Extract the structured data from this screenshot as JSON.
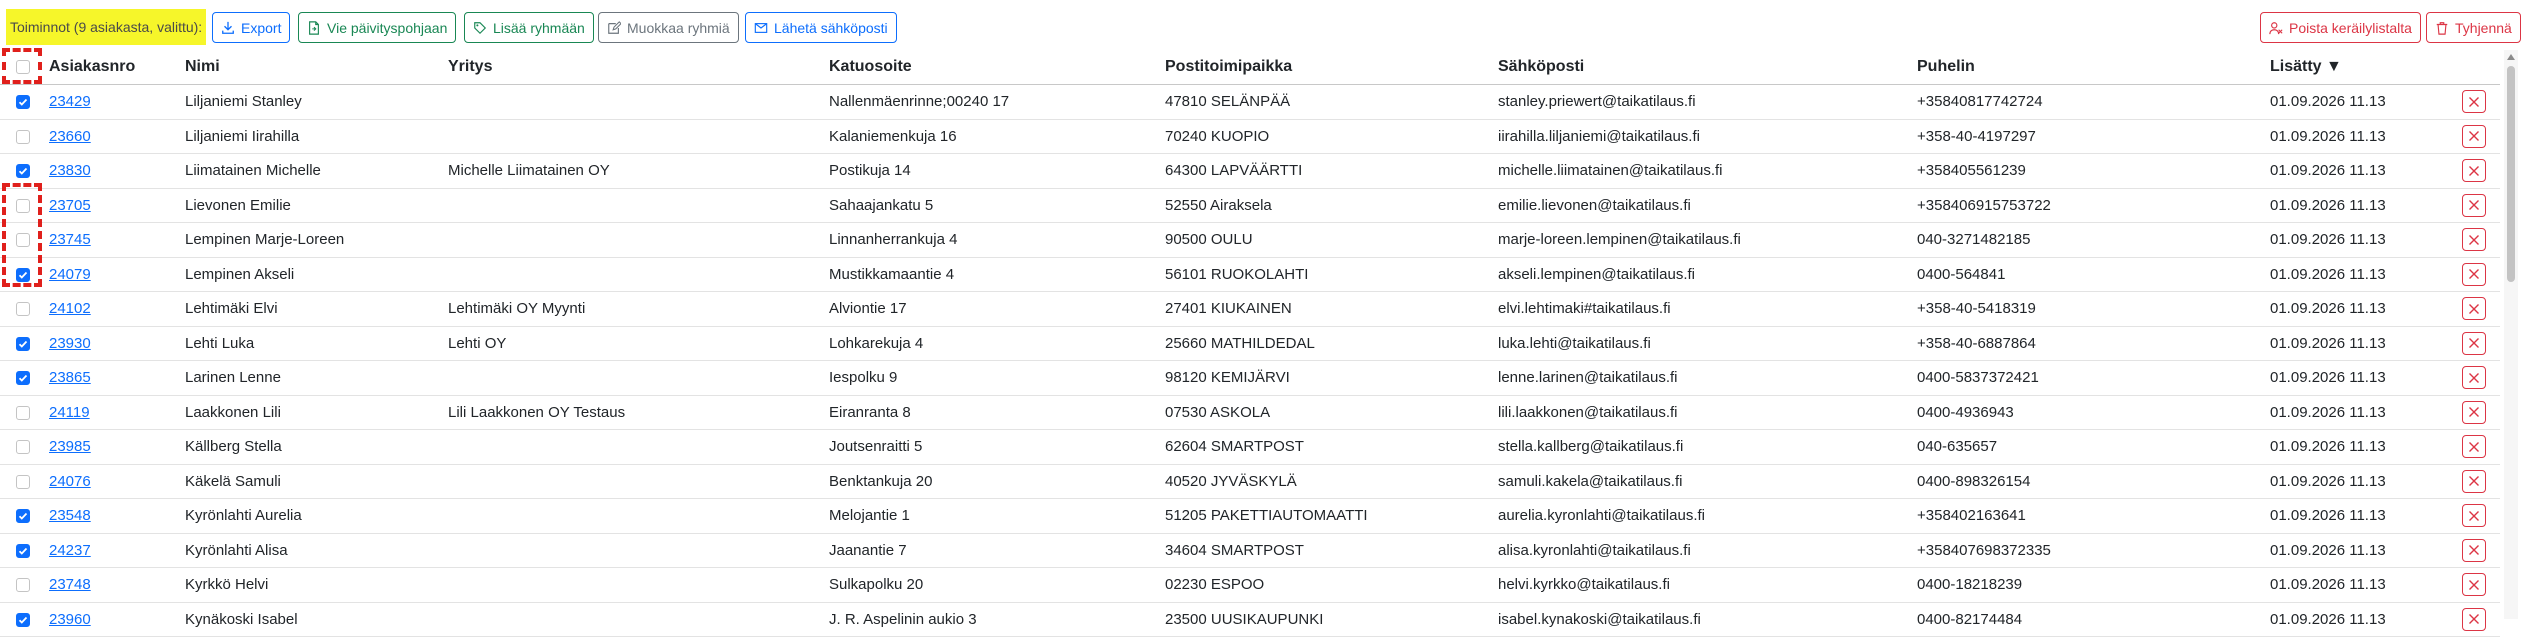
{
  "toolbar": {
    "actions_label": "Toiminnot (9 asiakasta, valittu):",
    "export_label": "Export",
    "update_base_label": "Vie päivityspohjaan",
    "add_group_label": "Lisää ryhmään",
    "edit_groups_label": "Muokkaa ryhmiä",
    "send_email_label": "Lähetä sähköposti",
    "remove_from_list_label": "Poista keräilylistalta",
    "clear_label": "Tyhjennä"
  },
  "table": {
    "headers": {
      "customer_no": "Asiakasnro",
      "name": "Nimi",
      "company": "Yritys",
      "address": "Katuosoite",
      "postal": "Postitoimipaikka",
      "email": "Sähköposti",
      "phone": "Puhelin",
      "added": "Lisätty ▼"
    },
    "rows": [
      {
        "checked": true,
        "customer_no": "23429",
        "name": "Liljaniemi Stanley",
        "company": "",
        "address": "Nallenmäenrinne;00240 17",
        "postal": "47810 SELÄNPÄÄ",
        "email": "stanley.priewert@taikatilaus.fi",
        "phone": "+35840817742724",
        "added": "01.09.2026 11.13"
      },
      {
        "checked": false,
        "customer_no": "23660",
        "name": "Liljaniemi Iirahilla",
        "company": "",
        "address": "Kalaniemenkuja 16",
        "postal": "70240 KUOPIO",
        "email": "iirahilla.liljaniemi@taikatilaus.fi",
        "phone": "+358-40-4197297",
        "added": "01.09.2026 11.13"
      },
      {
        "checked": true,
        "customer_no": "23830",
        "name": "Liimatainen Michelle",
        "company": "Michelle Liimatainen OY",
        "address": "Postikuja 14",
        "postal": "64300 LAPVÄÄRTTI",
        "email": "michelle.liimatainen@taikatilaus.fi",
        "phone": "+358405561239",
        "added": "01.09.2026 11.13"
      },
      {
        "checked": false,
        "customer_no": "23705",
        "name": "Lievonen Emilie",
        "company": "",
        "address": "Sahaajankatu 5",
        "postal": "52550 Airaksela",
        "email": "emilie.lievonen@taikatilaus.fi",
        "phone": "+358406915753722",
        "added": "01.09.2026 11.13"
      },
      {
        "checked": false,
        "customer_no": "23745",
        "name": "Lempinen Marje-Loreen",
        "company": "",
        "address": "Linnanherrankuja 4",
        "postal": "90500 OULU",
        "email": "marje-loreen.lempinen@taikatilaus.fi",
        "phone": "040-3271482185",
        "added": "01.09.2026 11.13"
      },
      {
        "checked": true,
        "customer_no": "24079",
        "name": "Lempinen Akseli",
        "company": "",
        "address": "Mustikkamaantie 4",
        "postal": "56101 RUOKOLAHTI",
        "email": "akseli.lempinen@taikatilaus.fi",
        "phone": "0400-564841",
        "added": "01.09.2026 11.13"
      },
      {
        "checked": false,
        "customer_no": "24102",
        "name": "Lehtimäki Elvi",
        "company": "Lehtimäki OY Myynti",
        "address": "Alviontie 17",
        "postal": "27401 KIUKAINEN",
        "email": "elvi.lehtimaki#taikatilaus.fi",
        "phone": "+358-40-5418319",
        "added": "01.09.2026 11.13"
      },
      {
        "checked": true,
        "customer_no": "23930",
        "name": "Lehti Luka",
        "company": "Lehti OY",
        "address": "Lohkarekuja 4",
        "postal": "25660 MATHILDEDAL",
        "email": "luka.lehti@taikatilaus.fi",
        "phone": "+358-40-6887864",
        "added": "01.09.2026 11.13"
      },
      {
        "checked": true,
        "customer_no": "23865",
        "name": "Larinen Lenne",
        "company": "",
        "address": "Iespolku 9",
        "postal": "98120 KEMIJÄRVI",
        "email": "lenne.larinen@taikatilaus.fi",
        "phone": "0400-5837372421",
        "added": "01.09.2026 11.13"
      },
      {
        "checked": false,
        "customer_no": "24119",
        "name": "Laakkonen Lili",
        "company": "Lili Laakkonen OY Testaus",
        "address": "Eiranranta 8",
        "postal": "07530 ASKOLA",
        "email": "lili.laakkonen@taikatilaus.fi",
        "phone": "0400-4936943",
        "added": "01.09.2026 11.13"
      },
      {
        "checked": false,
        "customer_no": "23985",
        "name": "Källberg Stella",
        "company": "",
        "address": "Joutsenraitti 5",
        "postal": "62604 SMARTPOST",
        "email": "stella.kallberg@taikatilaus.fi",
        "phone": "040-635657",
        "added": "01.09.2026 11.13"
      },
      {
        "checked": false,
        "customer_no": "24076",
        "name": "Käkelä Samuli",
        "company": "",
        "address": "Benktankuja 20",
        "postal": "40520 JYVÄSKYLÄ",
        "email": "samuli.kakela@taikatilaus.fi",
        "phone": "0400-898326154",
        "added": "01.09.2026 11.13"
      },
      {
        "checked": true,
        "customer_no": "23548",
        "name": "Kyrönlahti Aurelia",
        "company": "",
        "address": "Melojantie 1",
        "postal": "51205 PAKETTIAUTOMAATTI",
        "email": "aurelia.kyronlahti@taikatilaus.fi",
        "phone": "+358402163641",
        "added": "01.09.2026 11.13"
      },
      {
        "checked": true,
        "customer_no": "24237",
        "name": "Kyrönlahti Alisa",
        "company": "",
        "address": "Jaanantie 7",
        "postal": "34604 SMARTPOST",
        "email": "alisa.kyronlahti@taikatilaus.fi",
        "phone": "+358407698372335",
        "added": "01.09.2026 11.13"
      },
      {
        "checked": false,
        "customer_no": "23748",
        "name": "Kyrkkö Helvi",
        "company": "",
        "address": "Sulkapolku 20",
        "postal": "02230 ESPOO",
        "email": "helvi.kyrkko@taikatilaus.fi",
        "phone": "0400-18218239",
        "added": "01.09.2026 11.13"
      },
      {
        "checked": true,
        "customer_no": "23960",
        "name": "Kynäkoski Isabel",
        "company": "",
        "address": "J. R. Aspelinin aukio 3",
        "postal": "23500 UUSIKAUPUNKI",
        "email": "isabel.kynakoski@taikatilaus.fi",
        "phone": "0400-82174484",
        "added": "01.09.2026 11.13"
      }
    ]
  },
  "icons": {
    "export": "download-icon",
    "update_base": "file-export-icon",
    "add_group": "tag-icon",
    "edit_groups": "edit-icon",
    "send_email": "envelope-icon",
    "remove_from_list": "person-remove-icon",
    "clear": "trash-icon",
    "row_delete": "close-icon"
  },
  "colors": {
    "highlight": "#f6f62a",
    "primary": "#0d6efd",
    "success": "#198754",
    "secondary": "#6c757d",
    "danger": "#dc3545",
    "annotation": "#e0201c"
  }
}
